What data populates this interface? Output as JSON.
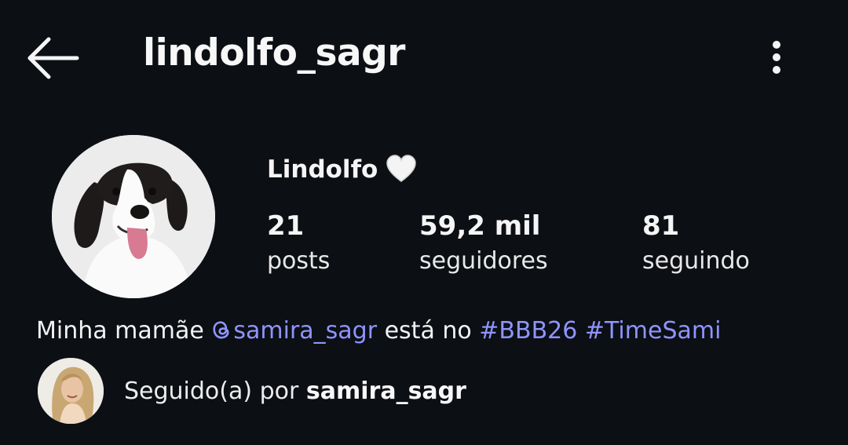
{
  "header": {
    "username": "lindolfo_sagr"
  },
  "profile": {
    "display_name": "Lindolfo",
    "stats": {
      "posts": {
        "count": "21",
        "label": "posts"
      },
      "followers": {
        "count": "59,2 mil",
        "label": "seguidores"
      },
      "following": {
        "count": "81",
        "label": "seguindo"
      }
    },
    "bio": {
      "prefix": "Minha mamãe ",
      "mention": "samira_sagr",
      "middle": " está no ",
      "hashtag1": "#BBB26",
      "hashtag2": "#TimeSami"
    },
    "followed_by": {
      "prefix": "Seguido(a) por ",
      "user": "samira_sagr"
    }
  },
  "colors": {
    "background": "#0c0f14",
    "link": "#8f94ff"
  },
  "icons": {
    "back": "arrow-left-icon",
    "more": "more-vertical-icon",
    "heart": "white-heart-icon",
    "threads": "threads-icon"
  }
}
